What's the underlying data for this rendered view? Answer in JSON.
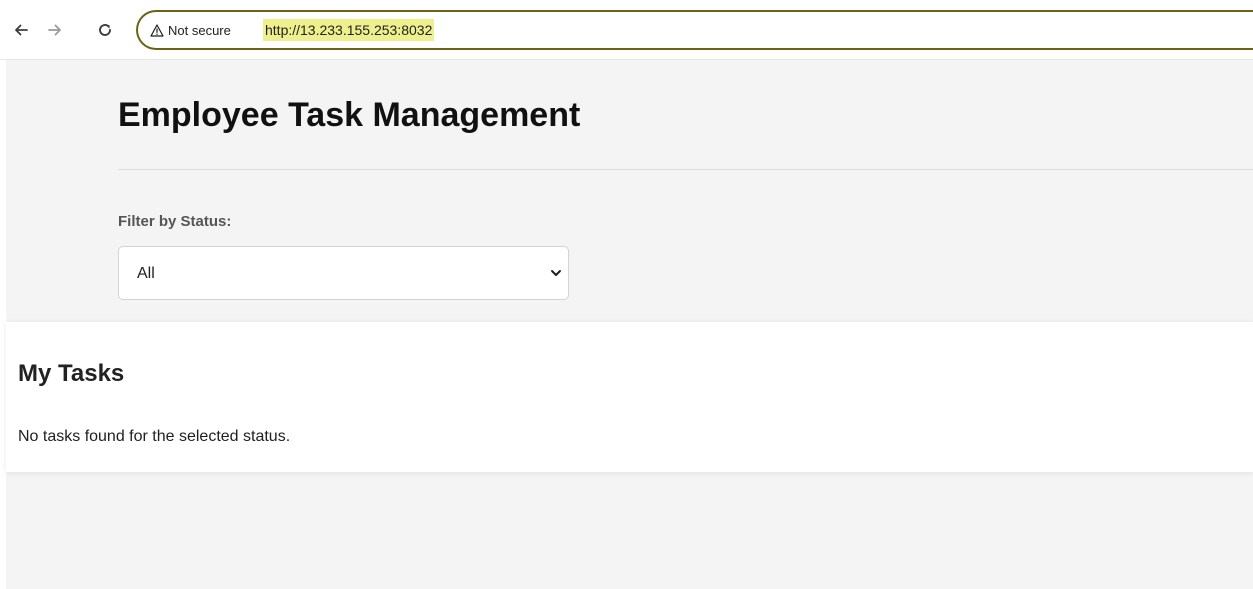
{
  "browser": {
    "security_label": "Not secure",
    "url": "http://13.233.155.253:8032",
    "icons": {
      "back": "arrow-left-icon",
      "forward": "arrow-right-icon",
      "reload": "reload-icon",
      "security": "warning-triangle-icon"
    }
  },
  "header": {
    "title": "Employee Task Management"
  },
  "filter": {
    "label": "Filter by Status:",
    "selected": "All"
  },
  "tasks": {
    "heading": "My Tasks",
    "empty_message": "No tasks found for the selected status."
  },
  "colors": {
    "page_background": "#f4f4f4",
    "omnibox_border": "#6b6215",
    "url_highlight": "#eef08e"
  }
}
